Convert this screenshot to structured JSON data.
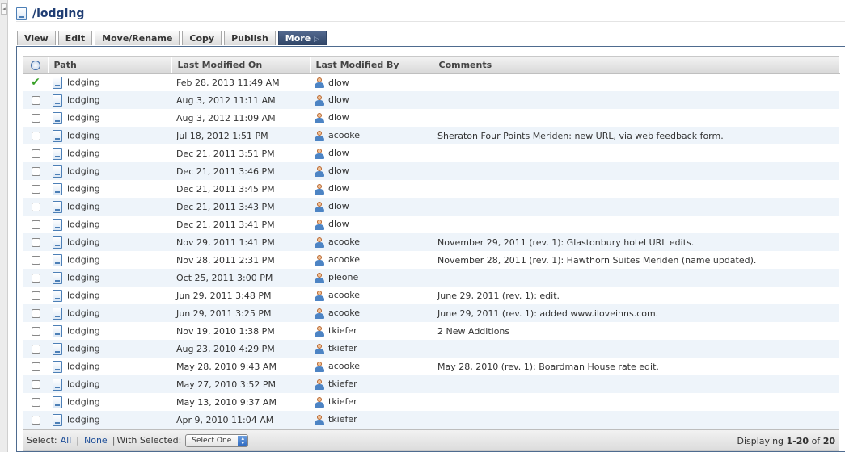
{
  "page": {
    "title": "/lodging"
  },
  "tabs": [
    {
      "label": "View"
    },
    {
      "label": "Edit"
    },
    {
      "label": "Move/Rename"
    },
    {
      "label": "Copy"
    },
    {
      "label": "Publish"
    },
    {
      "label": "More"
    }
  ],
  "table": {
    "columns": [
      "Path",
      "Last Modified On",
      "Last Modified By",
      "Comments"
    ],
    "rows": [
      {
        "path": "lodging",
        "modified_on": "Feb 28, 2013 11:49 AM",
        "modified_by": "dlow",
        "comment": "",
        "checked": true
      },
      {
        "path": "lodging",
        "modified_on": "Aug 3, 2012 11:11 AM",
        "modified_by": "dlow",
        "comment": "",
        "checked": false
      },
      {
        "path": "lodging",
        "modified_on": "Aug 3, 2012 11:09 AM",
        "modified_by": "dlow",
        "comment": "",
        "checked": false
      },
      {
        "path": "lodging",
        "modified_on": "Jul 18, 2012 1:51 PM",
        "modified_by": "acooke",
        "comment": "Sheraton Four Points Meriden: new URL, via web feedback form.",
        "checked": false
      },
      {
        "path": "lodging",
        "modified_on": "Dec 21, 2011 3:51 PM",
        "modified_by": "dlow",
        "comment": "",
        "checked": false
      },
      {
        "path": "lodging",
        "modified_on": "Dec 21, 2011 3:46 PM",
        "modified_by": "dlow",
        "comment": "",
        "checked": false
      },
      {
        "path": "lodging",
        "modified_on": "Dec 21, 2011 3:45 PM",
        "modified_by": "dlow",
        "comment": "",
        "checked": false
      },
      {
        "path": "lodging",
        "modified_on": "Dec 21, 2011 3:43 PM",
        "modified_by": "dlow",
        "comment": "",
        "checked": false
      },
      {
        "path": "lodging",
        "modified_on": "Dec 21, 2011 3:41 PM",
        "modified_by": "dlow",
        "comment": "",
        "checked": false
      },
      {
        "path": "lodging",
        "modified_on": "Nov 29, 2011 1:41 PM",
        "modified_by": "acooke",
        "comment": "November 29, 2011 (rev. 1): Glastonbury hotel URL edits.",
        "checked": false
      },
      {
        "path": "lodging",
        "modified_on": "Nov 28, 2011 2:31 PM",
        "modified_by": "acooke",
        "comment": "November 28, 2011 (rev. 1): Hawthorn Suites Meriden (name updated).",
        "checked": false
      },
      {
        "path": "lodging",
        "modified_on": "Oct 25, 2011 3:00 PM",
        "modified_by": "pleone",
        "comment": "",
        "checked": false
      },
      {
        "path": "lodging",
        "modified_on": "Jun 29, 2011 3:48 PM",
        "modified_by": "acooke",
        "comment": "June 29, 2011 (rev. 1): edit.",
        "checked": false
      },
      {
        "path": "lodging",
        "modified_on": "Jun 29, 2011 3:25 PM",
        "modified_by": "acooke",
        "comment": "June 29, 2011 (rev. 1): added www.iloveinns.com.",
        "checked": false
      },
      {
        "path": "lodging",
        "modified_on": "Nov 19, 2010 1:38 PM",
        "modified_by": "tkiefer",
        "comment": "2 New Additions",
        "checked": false
      },
      {
        "path": "lodging",
        "modified_on": "Aug 23, 2010 4:29 PM",
        "modified_by": "tkiefer",
        "comment": "",
        "checked": false
      },
      {
        "path": "lodging",
        "modified_on": "May 28, 2010 9:43 AM",
        "modified_by": "acooke",
        "comment": "May 28, 2010 (rev. 1): Boardman House rate edit.",
        "checked": false
      },
      {
        "path": "lodging",
        "modified_on": "May 27, 2010 3:52 PM",
        "modified_by": "tkiefer",
        "comment": "",
        "checked": false
      },
      {
        "path": "lodging",
        "modified_on": "May 13, 2010 9:37 AM",
        "modified_by": "tkiefer",
        "comment": "",
        "checked": false
      },
      {
        "path": "lodging",
        "modified_on": "Apr 9, 2010 11:04 AM",
        "modified_by": "tkiefer",
        "comment": "",
        "checked": false
      }
    ]
  },
  "footer": {
    "select_label": "Select:",
    "all_link": "All",
    "separator": "|",
    "none_link": "None",
    "with_selected_label": "With Selected:",
    "select_value": "Select One",
    "displaying_prefix": "Displaying",
    "displaying_range": "1-20",
    "displaying_of": "of",
    "displaying_total": "20"
  },
  "colors": {
    "accent": "#2f4466",
    "link": "#1f4f99",
    "title": "#1f3d73",
    "row_alt": "#eef4fa",
    "check": "#3aa12a"
  }
}
